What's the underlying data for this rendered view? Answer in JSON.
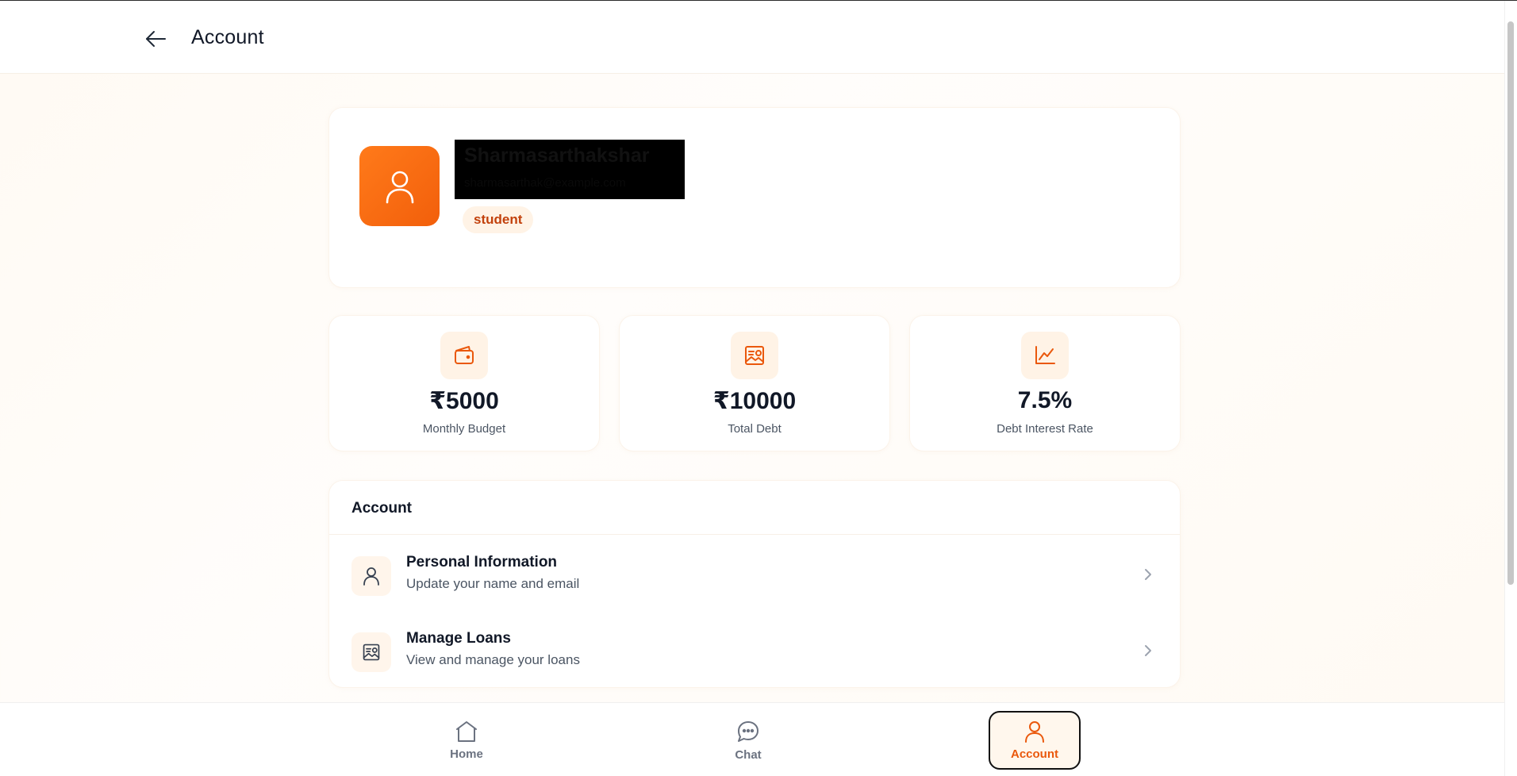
{
  "header": {
    "title": "Account",
    "back_icon": "arrow-left-icon"
  },
  "profile": {
    "name": "Sharmasarthakshar",
    "email": "sharmasarthak@example.com",
    "role": "student",
    "avatar_icon": "user-icon",
    "accent": "#f97316"
  },
  "stats": [
    {
      "icon": "wallet-icon",
      "value": "₹5000",
      "label": "Monthly Budget"
    },
    {
      "icon": "receipt-icon",
      "value": "₹10000",
      "label": "Total Debt"
    },
    {
      "icon": "trending-up-icon",
      "value": "7.5%",
      "label": "Debt Interest Rate"
    }
  ],
  "account_section": {
    "title": "Account",
    "items": [
      {
        "icon": "user-icon",
        "title": "Personal Information",
        "subtitle": "Update your name and email"
      },
      {
        "icon": "receipt-icon",
        "title": "Manage Loans",
        "subtitle": "View and manage your loans"
      }
    ]
  },
  "nav": {
    "items": [
      {
        "icon": "home-icon",
        "label": "Home"
      },
      {
        "icon": "chat-icon",
        "label": "Chat"
      },
      {
        "icon": "user-icon",
        "label": "Account",
        "active": true
      }
    ]
  },
  "colors": {
    "accent": "#ea580c",
    "badge_bg": "#fff3e6",
    "text_primary": "#111827",
    "text_secondary": "#4b5563"
  }
}
